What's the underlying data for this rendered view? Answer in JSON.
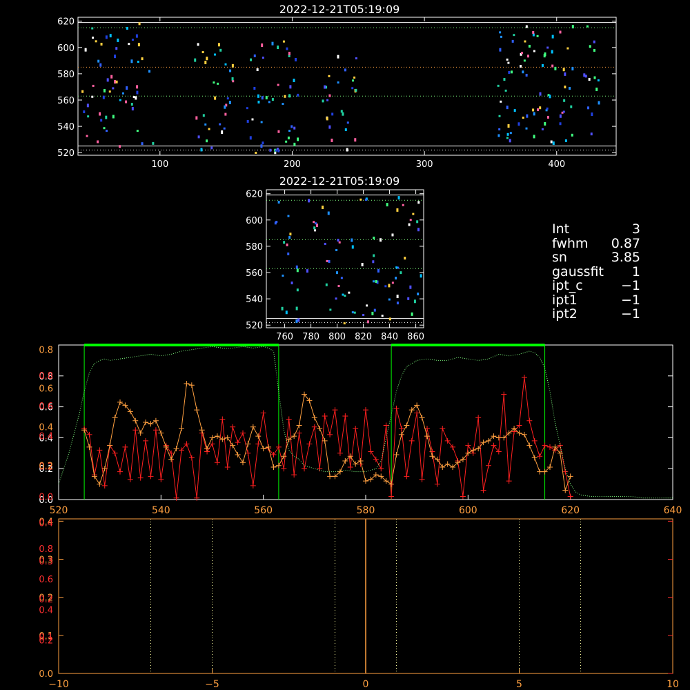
{
  "colors": {
    "background": "#000000",
    "axis": "#ffffff",
    "profile1": "#ff2020",
    "profile2": "#ffa040",
    "smooth": "#80ff80",
    "window": "#00ff00",
    "axis_red": "#ff3030",
    "axis_orange": "#ffa040"
  },
  "params": [
    {
      "name": "Int",
      "value": "3"
    },
    {
      "name": "fwhm",
      "value": "0.87"
    },
    {
      "name": "sn",
      "value": "3.85"
    },
    {
      "name": "gaussfit",
      "value": "1"
    },
    {
      "name": "ipt_c",
      "value": "−1"
    },
    {
      "name": "ipt1",
      "value": "−1"
    },
    {
      "name": "ipt2",
      "value": "−1"
    }
  ],
  "chart_data": [
    {
      "type": "heatmap",
      "title": "2022-12-21T05:19:09",
      "xticks": [
        "100",
        "200",
        "300",
        "400"
      ],
      "yticks": [
        "520",
        "540",
        "560",
        "580",
        "600",
        "620"
      ],
      "xlim": [
        38,
        445
      ],
      "ylim": [
        518,
        623
      ],
      "hlines": [
        {
          "y": 619,
          "style": "solid"
        },
        {
          "y": 615,
          "style": "dotted",
          "color": "#80ff80"
        },
        {
          "y": 585,
          "style": "dotted",
          "color": "#ffa040"
        },
        {
          "y": 563,
          "style": "dotted",
          "color": "#80ff80"
        },
        {
          "y": 525,
          "style": "solid"
        },
        {
          "y": 522,
          "style": "dotted"
        }
      ],
      "clusters": [
        {
          "x": [
            38,
            62
          ],
          "y": [
            520,
            621
          ],
          "n": 20
        },
        {
          "x": [
            55,
            95
          ],
          "y": [
            525,
            620
          ],
          "n": 38
        },
        {
          "x": [
            125,
            155
          ],
          "y": [
            520,
            605
          ],
          "n": 32
        },
        {
          "x": [
            165,
            205
          ],
          "y": [
            520,
            612
          ],
          "n": 48
        },
        {
          "x": [
            220,
            248
          ],
          "y": [
            522,
            595
          ],
          "n": 26
        },
        {
          "x": [
            355,
            395
          ],
          "y": [
            528,
            620
          ],
          "n": 58
        },
        {
          "x": [
            395,
            412
          ],
          "y": [
            525,
            621
          ],
          "n": 22
        },
        {
          "x": [
            420,
            432
          ],
          "y": [
            528,
            622
          ],
          "n": 14
        }
      ]
    },
    {
      "type": "heatmap",
      "title": "2022-12-21T05:19:09",
      "xticks": [
        "760",
        "780",
        "800",
        "820",
        "840",
        "860"
      ],
      "yticks": [
        "520",
        "540",
        "560",
        "580",
        "600",
        "620"
      ],
      "xlim": [
        746,
        866
      ],
      "ylim": [
        518,
        623
      ],
      "hlines": [
        {
          "y": 619,
          "style": "solid"
        },
        {
          "y": 615,
          "style": "dotted",
          "color": "#80ff80"
        },
        {
          "y": 585,
          "style": "dotted",
          "color": "#80ff80"
        },
        {
          "y": 563,
          "style": "dotted",
          "color": "#80ff80"
        },
        {
          "y": 525,
          "style": "solid"
        },
        {
          "y": 522,
          "style": "dotted"
        }
      ],
      "clusters": [
        {
          "x": [
            748,
            865
          ],
          "y": [
            522,
            620
          ],
          "n": 95
        }
      ]
    },
    {
      "type": "line",
      "xticks": [
        "520",
        "540",
        "560",
        "580",
        "600",
        "620",
        "640"
      ],
      "xlim": [
        520,
        640
      ],
      "ylim": [
        0,
        1
      ],
      "yticks_white": [
        "0.0",
        "0.2",
        "0.4",
        "0.6",
        "0.8"
      ],
      "yticks_red": [
        "0.0",
        "0.2",
        "0.4",
        "0.6",
        "0.8"
      ],
      "yticks_orange": [
        "0.2",
        "0.4",
        "0.6",
        "0.8"
      ],
      "windows": [
        [
          525,
          563
        ],
        [
          585,
          615
        ]
      ],
      "series": [
        {
          "color": "red",
          "x": [
            525,
            526,
            527,
            528,
            529,
            530,
            531,
            532,
            533,
            534,
            535,
            536,
            537,
            538,
            539,
            540,
            541,
            542,
            543,
            544,
            545,
            546,
            547,
            548,
            549,
            550,
            551,
            552,
            553,
            554,
            555,
            556,
            557,
            558,
            559,
            560,
            561,
            562,
            563,
            564,
            565,
            566,
            567,
            568,
            569,
            570,
            571,
            572,
            573,
            574,
            575,
            576,
            577,
            578,
            579,
            580,
            581,
            582,
            583,
            584,
            585,
            586,
            587,
            588,
            589,
            590,
            591,
            592,
            593,
            594,
            595,
            596,
            597,
            598,
            599,
            600,
            601,
            602,
            603,
            604,
            605,
            606,
            607,
            608,
            609,
            610,
            611,
            612,
            613,
            614,
            615,
            616,
            617,
            618,
            619,
            620
          ],
          "y": [
            0.46,
            0.42,
            0.16,
            0.32,
            0.09,
            0.35,
            0.3,
            0.18,
            0.34,
            0.13,
            0.45,
            0.14,
            0.38,
            0.15,
            0.45,
            0.13,
            0.35,
            0.3,
            0.01,
            0.32,
            0.36,
            0.27,
            0.01,
            0.43,
            0.31,
            0.36,
            0.24,
            0.52,
            0.21,
            0.47,
            0.37,
            0.43,
            0.3,
            0.09,
            0.36,
            0.56,
            0.33,
            0.29,
            0.34,
            0.2,
            0.52,
            0.16,
            0.43,
            0.2,
            0.36,
            0.47,
            0.2,
            0.54,
            0.42,
            0.58,
            0.3,
            0.54,
            0.21,
            0.46,
            0.23,
            0.58,
            0.31,
            0.26,
            0.2,
            0.48,
            0.02,
            0.59,
            0.46,
            0.15,
            0.38,
            0.56,
            0.13,
            0.46,
            0.31,
            0.1,
            0.46,
            0.38,
            0.34,
            0.25,
            0.02,
            0.35,
            0.3,
            0.53,
            0.06,
            0.22,
            0.35,
            0.31,
            0.68,
            0.12,
            0.44,
            0.48,
            0.79,
            0.51,
            0.38,
            0.28,
            0.35,
            0.34,
            0.32,
            0.35,
            0.18,
            0.02
          ]
        },
        {
          "color": "orange",
          "x": [
            525,
            526,
            527,
            528,
            529,
            530,
            531,
            532,
            533,
            534,
            535,
            536,
            537,
            538,
            539,
            540,
            541,
            542,
            543,
            544,
            545,
            546,
            547,
            548,
            549,
            550,
            551,
            552,
            553,
            554,
            555,
            556,
            557,
            558,
            559,
            560,
            561,
            562,
            563,
            564,
            565,
            566,
            567,
            568,
            569,
            570,
            571,
            572,
            573,
            574,
            575,
            576,
            577,
            578,
            579,
            580,
            581,
            582,
            583,
            584,
            585,
            586,
            587,
            588,
            589,
            590,
            591,
            592,
            593,
            594,
            595,
            596,
            597,
            598,
            599,
            600,
            601,
            602,
            603,
            604,
            605,
            606,
            607,
            608,
            609,
            610,
            611,
            612,
            613,
            614,
            615,
            616,
            617,
            618,
            619,
            620
          ],
          "y": [
            0.45,
            0.34,
            0.15,
            0.1,
            0.2,
            0.35,
            0.53,
            0.63,
            0.61,
            0.57,
            0.51,
            0.43,
            0.5,
            0.49,
            0.51,
            0.43,
            0.34,
            0.26,
            0.33,
            0.46,
            0.75,
            0.74,
            0.58,
            0.45,
            0.33,
            0.4,
            0.41,
            0.39,
            0.4,
            0.35,
            0.29,
            0.24,
            0.36,
            0.47,
            0.41,
            0.33,
            0.34,
            0.21,
            0.22,
            0.28,
            0.39,
            0.41,
            0.48,
            0.68,
            0.64,
            0.53,
            0.46,
            0.38,
            0.15,
            0.15,
            0.18,
            0.25,
            0.28,
            0.23,
            0.25,
            0.12,
            0.13,
            0.16,
            0.15,
            0.12,
            0.1,
            0.29,
            0.42,
            0.48,
            0.58,
            0.61,
            0.53,
            0.41,
            0.28,
            0.26,
            0.21,
            0.23,
            0.21,
            0.24,
            0.26,
            0.3,
            0.32,
            0.33,
            0.37,
            0.38,
            0.41,
            0.4,
            0.4,
            0.43,
            0.46,
            0.43,
            0.42,
            0.35,
            0.27,
            0.18,
            0.18,
            0.21,
            0.34,
            0.3,
            0.06,
            0.15
          ]
        },
        {
          "color": "green-dotted",
          "x": [
            520,
            522,
            524,
            525,
            526,
            527,
            528,
            529,
            530,
            532,
            534,
            536,
            538,
            540,
            542,
            544,
            546,
            548,
            550,
            552,
            554,
            556,
            558,
            560,
            561,
            562,
            563,
            564,
            565,
            566,
            567,
            568,
            570,
            572,
            574,
            576,
            578,
            580,
            582,
            583,
            584,
            585,
            586,
            587,
            588,
            590,
            592,
            594,
            596,
            598,
            600,
            602,
            604,
            606,
            608,
            610,
            612,
            613,
            614,
            615,
            616,
            617,
            618,
            619,
            620,
            621,
            622,
            624,
            626,
            628,
            630,
            632,
            634,
            636,
            638,
            640
          ],
          "y": [
            0.1,
            0.3,
            0.55,
            0.7,
            0.82,
            0.88,
            0.9,
            0.91,
            0.9,
            0.91,
            0.92,
            0.93,
            0.94,
            0.93,
            0.94,
            0.96,
            0.97,
            0.98,
            0.99,
            0.98,
            0.98,
            0.99,
            0.98,
            0.99,
            0.98,
            0.96,
            0.7,
            0.45,
            0.32,
            0.28,
            0.26,
            0.22,
            0.2,
            0.18,
            0.18,
            0.19,
            0.18,
            0.18,
            0.2,
            0.25,
            0.4,
            0.55,
            0.7,
            0.8,
            0.86,
            0.9,
            0.91,
            0.9,
            0.9,
            0.92,
            0.91,
            0.9,
            0.91,
            0.94,
            0.93,
            0.94,
            0.96,
            0.95,
            0.92,
            0.85,
            0.7,
            0.5,
            0.35,
            0.2,
            0.1,
            0.05,
            0.03,
            0.02,
            0.02,
            0.02,
            0.02,
            0.02,
            0.01,
            0.01,
            0.01,
            0.01
          ]
        }
      ]
    },
    {
      "type": "line",
      "xticks": [
        "−10",
        "−5",
        "0",
        "5",
        "10"
      ],
      "xlim": [
        -10,
        10
      ],
      "ylim": [
        0,
        1
      ],
      "yticks_white": [
        "0.0",
        "0.1",
        "0.2",
        "0.3",
        "0.4"
      ],
      "yticks_red": [
        "0.0",
        "0.2",
        "0.4",
        "0.6",
        "0.8"
      ],
      "yticks_orange": [
        "0.1",
        "0.2",
        "0.3",
        "0.4"
      ],
      "vlines_dotted": [
        -7,
        -5,
        -1,
        1,
        5,
        7
      ],
      "vline_solid": 0
    }
  ]
}
